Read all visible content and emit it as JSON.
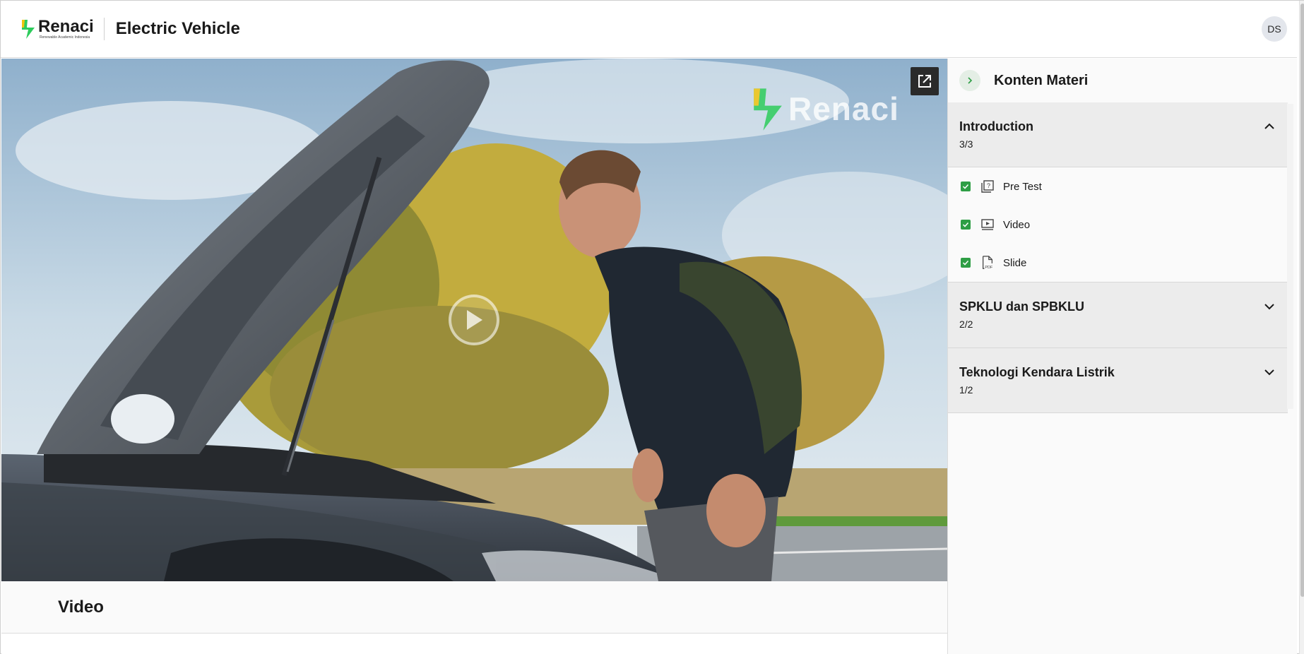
{
  "header": {
    "logo_word": "Renaci",
    "logo_sub": "Renewable Academic Indonesia",
    "title": "Electric Vehicle",
    "avatar_initials": "DS"
  },
  "video": {
    "watermark_word": "Renaci",
    "popout_icon": "open-in-new-icon",
    "play_icon": "play-icon"
  },
  "content": {
    "section_title": "Video"
  },
  "sidebar": {
    "title": "Konten Materi",
    "toggle_icon": "chevron-right-icon",
    "modules": [
      {
        "title": "Introduction",
        "count": "3/3",
        "expanded": true,
        "items": [
          {
            "label": "Pre Test",
            "icon": "quiz-icon",
            "checked": true
          },
          {
            "label": "Video",
            "icon": "video-icon",
            "checked": true
          },
          {
            "label": "Slide",
            "icon": "pdf-icon",
            "checked": true
          }
        ]
      },
      {
        "title": "SPKLU dan SPBKLU",
        "count": "2/2",
        "expanded": false
      },
      {
        "title": "Teknologi Kendara Listrik",
        "count": "1/2",
        "expanded": false
      }
    ]
  },
  "colors": {
    "brand_green": "#2e9e45",
    "accent_light_green": "#e4eee5"
  }
}
